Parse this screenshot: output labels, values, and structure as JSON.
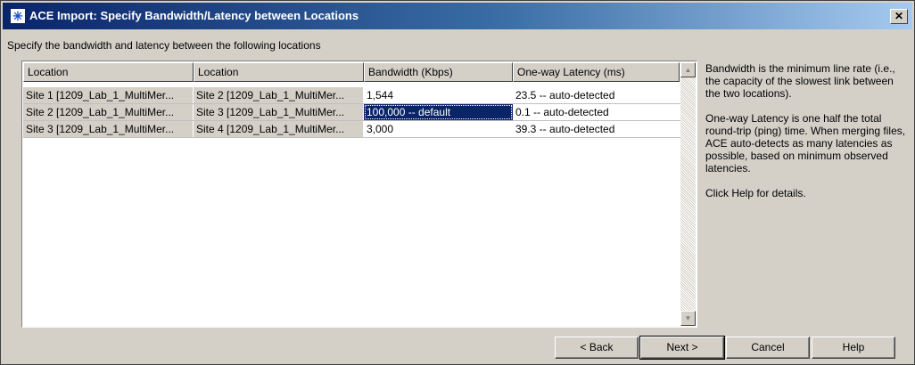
{
  "window": {
    "title": "ACE Import: Specify Bandwidth/Latency between Locations",
    "close_glyph": "✕",
    "title_icon": "asterisk-app-icon"
  },
  "instruction": "Specify the bandwidth and latency between the following locations",
  "table": {
    "columns": [
      "Location",
      "Location",
      "Bandwidth (Kbps)",
      "One-way Latency (ms)"
    ],
    "rows": [
      [
        "Site 1 [1209_Lab_1_MultiMer...",
        "Site 2 [1209_Lab_1_MultiMer...",
        "1,544",
        "23.5 -- auto-detected"
      ],
      [
        "Site 2 [1209_Lab_1_MultiMer...",
        "Site 3 [1209_Lab_1_MultiMer...",
        "100,000 -- default",
        "0.1 -- auto-detected"
      ],
      [
        "Site 3 [1209_Lab_1_MultiMer...",
        "Site 4 [1209_Lab_1_MultiMer...",
        "3,000",
        "39.3 -- auto-detected"
      ]
    ],
    "selected_cell": {
      "row": 1,
      "col": 2
    }
  },
  "help": {
    "p1": "Bandwidth is the minimum line rate (i.e., the capacity of the slowest link between the two locations).",
    "p2": "One-way Latency is one half the total round-trip (ping) time.  When merging files, ACE auto-detects as many latencies as possible, based on minimum observed latencies.",
    "p3": "Click Help for details."
  },
  "buttons": {
    "back": "< Back",
    "next": "Next >",
    "cancel": "Cancel",
    "help": "Help"
  },
  "colors": {
    "titlebar_start": "#0a246a",
    "titlebar_end": "#a6caf0",
    "selection": "#0a246a",
    "dialog_face": "#d4d0c8"
  }
}
